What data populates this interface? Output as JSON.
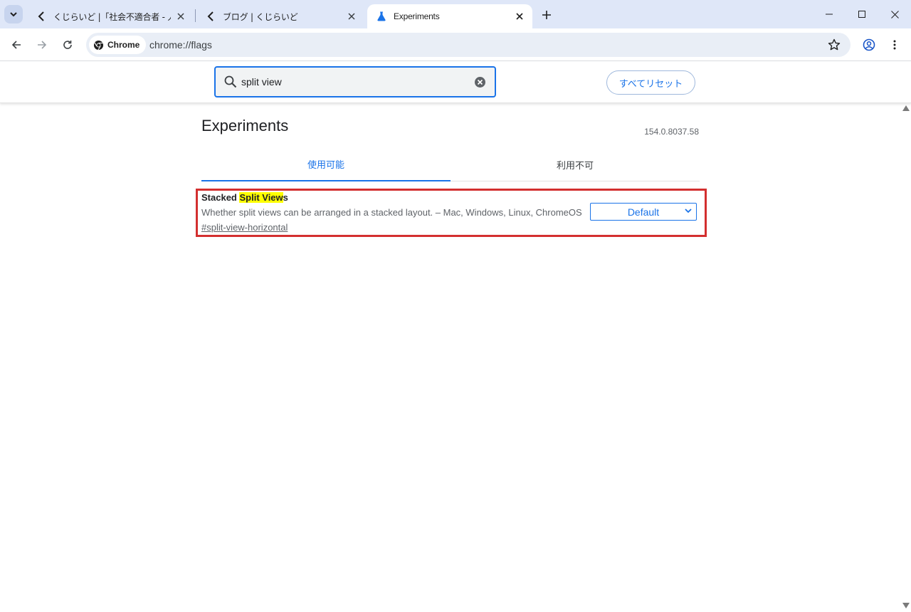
{
  "browser": {
    "tabs": [
      {
        "title": "くじらいど |「社会不適合者 - 人生"
      },
      {
        "title": "ブログ | くじらいど"
      },
      {
        "title": "Experiments"
      }
    ],
    "chip_label": "Chrome",
    "url": "chrome://flags"
  },
  "flags_header": {
    "search_value": "split view",
    "reset_label": "すべてリセット"
  },
  "main": {
    "title": "Experiments",
    "version": "154.0.8037.58",
    "tabs": [
      {
        "label": "使用可能"
      },
      {
        "label": "利用不可"
      }
    ]
  },
  "flag": {
    "name_prefix": "Stacked ",
    "name_highlight": "Split View",
    "name_suffix": "s",
    "description": "Whether split views can be arranged in a stacked layout. – Mac, Windows, Linux, ChromeOS",
    "link": "#split-view-horizontal",
    "select_value": "Default"
  },
  "colors": {
    "accent": "#1a73e8",
    "highlight": "#ffff00",
    "annotation_border": "#d32f2f",
    "tabstrip_bg": "#dfe7f8"
  },
  "icons": [
    "chevron-down-icon",
    "back-chevron-icon",
    "close-icon",
    "flask-icon",
    "plus-icon",
    "minimize-icon",
    "maximize-icon",
    "arrow-left-icon",
    "arrow-right-icon",
    "reload-icon",
    "chrome-logo-icon",
    "star-icon",
    "profile-icon",
    "more-vert-icon",
    "search-icon",
    "clear-icon"
  ]
}
